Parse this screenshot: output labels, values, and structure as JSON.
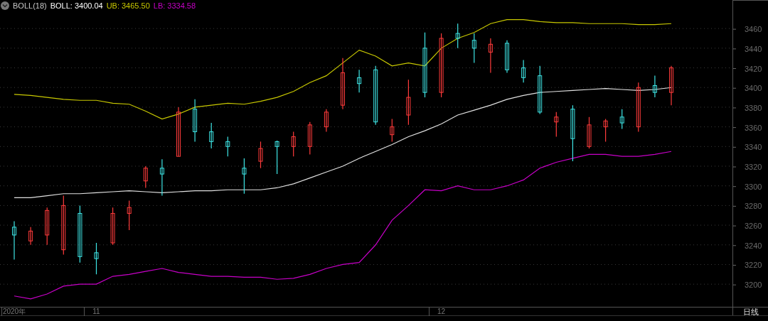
{
  "legend": {
    "collapse_icon": true,
    "title": "BOLL(18)",
    "values": [
      "3400.04",
      "3465.50",
      "3334.58"
    ]
  },
  "chart_data": {
    "type": "candlestick",
    "categories": [
      "2020年",
      null,
      null,
      null,
      null,
      "11",
      null,
      null,
      null,
      null,
      null,
      null,
      null,
      null,
      null,
      null,
      null,
      null,
      null,
      null,
      null,
      null,
      null,
      null,
      null,
      null,
      "12",
      null,
      null,
      null,
      null,
      null,
      null,
      null,
      null,
      null,
      null,
      null,
      null,
      null,
      null
    ],
    "yticks": [
      3200,
      3220,
      3240,
      3260,
      3280,
      3300,
      3320,
      3340,
      3360,
      3380,
      3400,
      3420,
      3440,
      3460
    ],
    "ylim": [
      3177,
      3489
    ],
    "grid": true,
    "ohlc": [
      [
        3258,
        3264,
        3225,
        3250
      ],
      [
        3244,
        3258,
        3240,
        3254
      ],
      [
        3250,
        3278,
        3240,
        3275
      ],
      [
        3235,
        3290,
        3230,
        3280
      ],
      [
        3272,
        3280,
        3222,
        3228
      ],
      [
        3232,
        3242,
        3210,
        3226
      ],
      [
        3242,
        3278,
        3240,
        3272
      ],
      [
        3272,
        3285,
        3255,
        3278
      ],
      [
        3305,
        3320,
        3298,
        3318
      ],
      [
        3318,
        3327,
        3290,
        3312
      ],
      [
        3330,
        3380,
        3330,
        3375
      ],
      [
        3378,
        3388,
        3345,
        3355
      ],
      [
        3355,
        3364,
        3338,
        3345
      ],
      [
        3345,
        3350,
        3330,
        3340
      ],
      [
        3318,
        3328,
        3292,
        3312
      ],
      [
        3325,
        3345,
        3318,
        3338
      ],
      [
        3345,
        3346,
        3312,
        3340
      ],
      [
        3340,
        3355,
        3330,
        3350
      ],
      [
        3340,
        3365,
        3332,
        3362
      ],
      [
        3360,
        3378,
        3355,
        3375
      ],
      [
        3382,
        3430,
        3378,
        3415
      ],
      [
        3410,
        3418,
        3395,
        3404
      ],
      [
        3418,
        3422,
        3362,
        3365
      ],
      [
        3352,
        3368,
        3345,
        3360
      ],
      [
        3372,
        3408,
        3362,
        3390
      ],
      [
        3440,
        3456,
        3390,
        3395
      ],
      [
        3395,
        3455,
        3390,
        3450
      ],
      [
        3455,
        3465,
        3440,
        3450
      ],
      [
        3448,
        3455,
        3425,
        3440
      ],
      [
        3436,
        3450,
        3415,
        3444
      ],
      [
        3445,
        3448,
        3415,
        3418
      ],
      [
        3420,
        3428,
        3405,
        3410
      ],
      [
        3412,
        3422,
        3373,
        3375
      ],
      [
        3365,
        3375,
        3350,
        3370
      ],
      [
        3378,
        3382,
        3325,
        3348
      ],
      [
        3340,
        3370,
        3338,
        3362
      ],
      [
        3360,
        3368,
        3345,
        3366
      ],
      [
        3370,
        3378,
        3358,
        3364
      ],
      [
        3360,
        3405,
        3355,
        3400
      ],
      [
        3402,
        3412,
        3390,
        3395
      ],
      [
        3395,
        3422,
        3382,
        3420
      ]
    ],
    "series": [
      {
        "name": "BOLL:",
        "type": "line",
        "color": "#e0e0e0",
        "values": [
          3288,
          3288,
          3290,
          3292,
          3292,
          3293,
          3294,
          3295,
          3294,
          3293,
          3294,
          3295,
          3295,
          3296,
          3296,
          3296,
          3298,
          3302,
          3308,
          3314,
          3320,
          3328,
          3335,
          3342,
          3350,
          3356,
          3363,
          3372,
          3377,
          3382,
          3388,
          3392,
          3395,
          3396,
          3397,
          3398,
          3399,
          3398,
          3397,
          3398,
          3400
        ]
      },
      {
        "name": "UB:",
        "type": "line",
        "color": "#c8c800",
        "values": [
          3393,
          3392,
          3390,
          3388,
          3387,
          3387,
          3384,
          3383,
          3376,
          3368,
          3373,
          3380,
          3382,
          3384,
          3383,
          3386,
          3390,
          3396,
          3405,
          3412,
          3425,
          3438,
          3432,
          3422,
          3425,
          3422,
          3440,
          3450,
          3456,
          3465,
          3469,
          3469,
          3467,
          3466,
          3466,
          3465,
          3465,
          3465,
          3464,
          3464,
          3465
        ]
      },
      {
        "name": "LB:",
        "type": "line",
        "color": "#c800c8",
        "values": [
          3188,
          3185,
          3190,
          3198,
          3200,
          3200,
          3208,
          3210,
          3213,
          3216,
          3212,
          3210,
          3208,
          3208,
          3207,
          3207,
          3205,
          3206,
          3210,
          3216,
          3220,
          3222,
          3240,
          3265,
          3280,
          3296,
          3295,
          3300,
          3296,
          3296,
          3300,
          3306,
          3318,
          3324,
          3328,
          3332,
          3332,
          3330,
          3330,
          3332,
          3335
        ]
      }
    ]
  },
  "period_button": "日线"
}
